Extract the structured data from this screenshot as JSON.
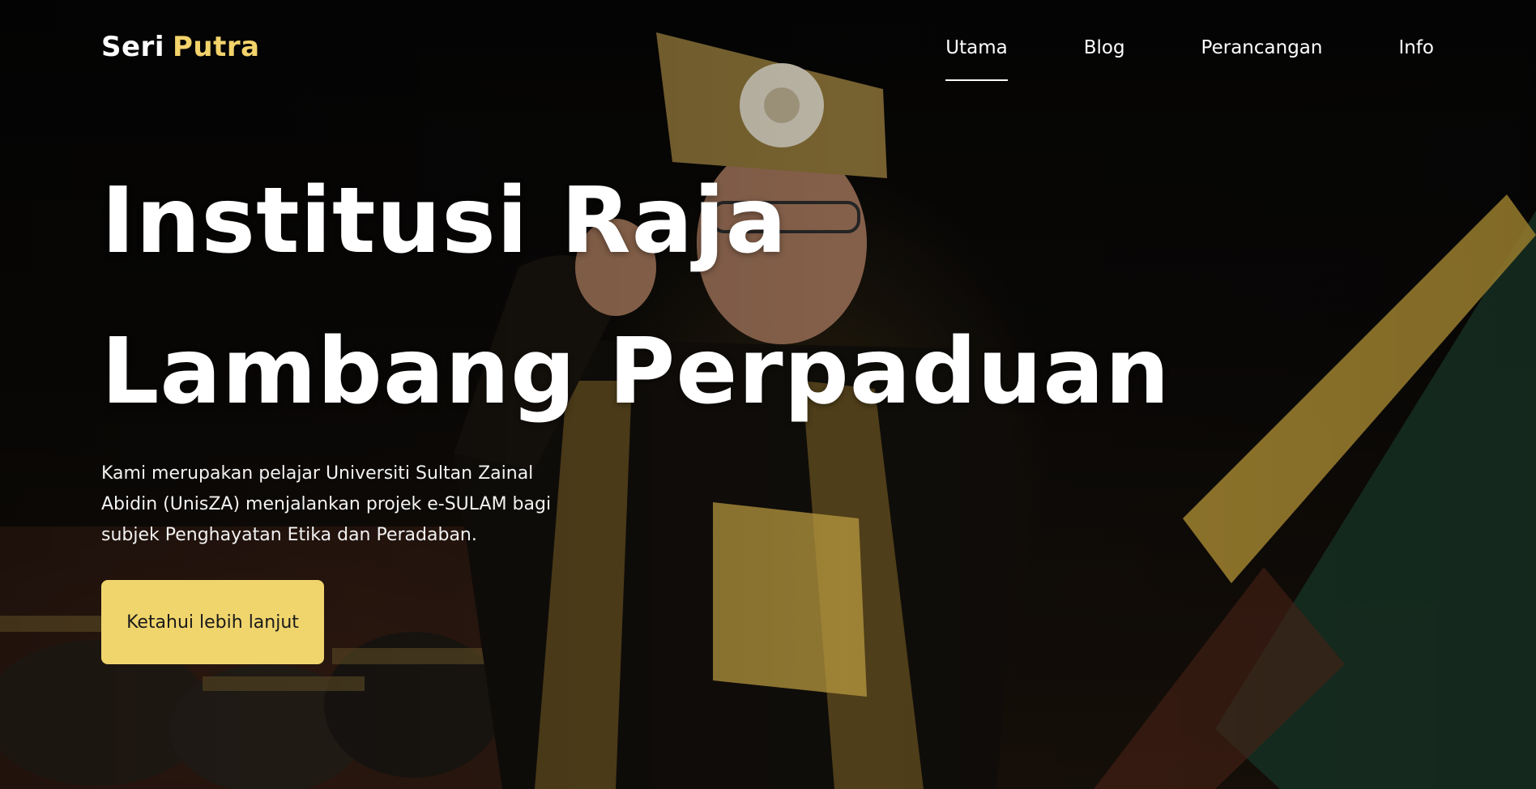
{
  "brand": {
    "word1": "Seri",
    "word2": "Putra"
  },
  "nav": {
    "items": [
      {
        "label": "Utama",
        "active": true
      },
      {
        "label": "Blog",
        "active": false
      },
      {
        "label": "Perancangan",
        "active": false
      },
      {
        "label": "Info",
        "active": false
      }
    ]
  },
  "hero": {
    "title_line1": "Institusi Raja",
    "title_line2": "Lambang Perpaduan",
    "description": "Kami merupakan pelajar Universiti Sultan Zainal Abidin (UnisZA) menjalankan projek e-SULAM bagi subjek Penghayatan Etika dan Peradaban.",
    "cta_label": "Ketahui lebih lanjut"
  },
  "colors": {
    "accent": "#f0d56d",
    "brand_accent": "#f3d36b",
    "background": "#0b0a08"
  }
}
